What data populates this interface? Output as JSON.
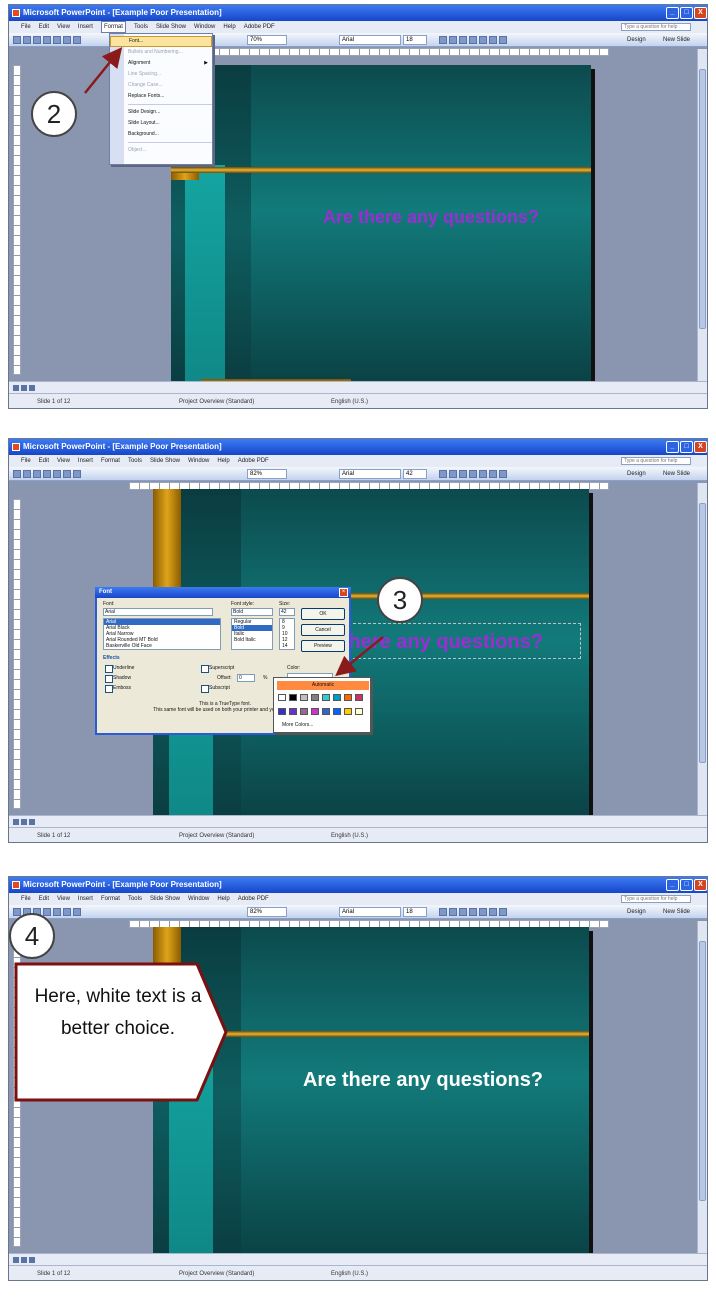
{
  "window": {
    "title": "Microsoft PowerPoint - [Example Poor Presentation]",
    "help_placeholder": "Type a question for help",
    "minimize": "_",
    "maximize": "□",
    "close": "X"
  },
  "menu": [
    "File",
    "Edit",
    "View",
    "Insert",
    "Format",
    "Tools",
    "Slide Show",
    "Window",
    "Help",
    "Adobe PDF"
  ],
  "toolbar": {
    "font": "Arial",
    "design": "Design",
    "new_slide": "New Slide"
  },
  "panels": [
    {
      "zoom": "70%",
      "font_size": "18"
    },
    {
      "zoom": "82%",
      "font_size": "42"
    },
    {
      "zoom": "82%",
      "font_size": "18"
    }
  ],
  "slide": {
    "text": "Are there any questions?"
  },
  "status": {
    "slide": "Slide 1 of 12",
    "template": "Project Overview (Standard)",
    "language": "English (U.S.)"
  },
  "format_menu": {
    "items": [
      {
        "label": "Font...",
        "state": "highlighted"
      },
      {
        "label": "Bullets and Numbering...",
        "state": "disabled"
      },
      {
        "label": "Alignment",
        "state": "normal",
        "submenu": true
      },
      {
        "label": "Line Spacing...",
        "state": "disabled"
      },
      {
        "label": "Change Case...",
        "state": "disabled"
      },
      {
        "label": "Replace Fonts...",
        "state": "normal"
      },
      {
        "label": "Slide Design...",
        "state": "normal"
      },
      {
        "label": "Slide Layout...",
        "state": "normal"
      },
      {
        "label": "Background...",
        "state": "normal"
      },
      {
        "label": "Object...",
        "state": "disabled"
      }
    ]
  },
  "font_dialog": {
    "title": "Font",
    "font_label": "Font:",
    "font_value": "Arial",
    "font_list": [
      "Arial",
      "Arial Black",
      "Arial Narrow",
      "Arial Rounded MT Bold",
      "Baskerville Old Face"
    ],
    "style_label": "Font style:",
    "style_value": "Bold",
    "style_list": [
      "Regular",
      "Bold",
      "Italic",
      "Bold Italic"
    ],
    "size_label": "Size:",
    "size_value": "42",
    "size_list": [
      "8",
      "9",
      "10",
      "12",
      "14"
    ],
    "ok": "OK",
    "cancel": "Cancel",
    "preview": "Preview",
    "effects_label": "Effects",
    "underline": "Underline",
    "shadow": "Shadow",
    "emboss": "Emboss",
    "superscript": "Superscript",
    "offset_label": "Offset:",
    "offset_value": "0",
    "percent": "%",
    "subscript": "Subscript",
    "color_label": "Color:",
    "note1": "This is a TrueType font.",
    "note2": "This same font will be used on both your printer and your screen."
  },
  "color_popup": {
    "automatic": "Automatic",
    "more_colors": "More Colors...",
    "row1": [
      "#ffffff",
      "#000000",
      "#c0c0c0",
      "#808080",
      "#33cccc",
      "#0099cc",
      "#ff6600",
      "#cc3366"
    ],
    "row2": [
      "#3333cc",
      "#6633cc",
      "#996699",
      "#cc33cc",
      "#3366cc",
      "#0066ff",
      "#ffcc00",
      "#ffffcc"
    ]
  },
  "callouts": {
    "step2": "2",
    "step3": "3",
    "step4": "4",
    "note": "Here, white text is a better choice."
  },
  "colors": {
    "arrow": "#8b1a1a",
    "slide_text_purple": "#9a2ed2",
    "slide_text_white": "#ffffff",
    "callout_border": "#7a1010"
  }
}
